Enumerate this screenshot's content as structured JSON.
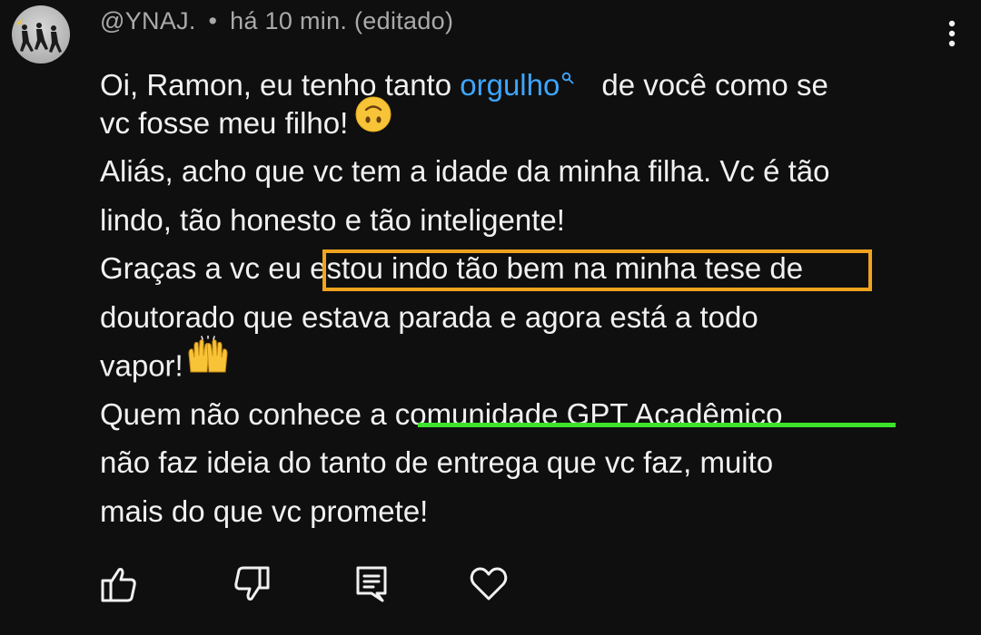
{
  "comment": {
    "author": "@YNAJ.",
    "separator": "•",
    "timestamp": "há 10 min.",
    "edited": "(editado)",
    "lines": {
      "l1_before": "Oi, Ramon, eu tenho tanto ",
      "l1_link": "orgulho",
      "l1_after": "de você como se",
      "l2": "vc fosse meu filho!",
      "l3": "Aliás, acho que vc tem a idade da minha filha. Vc é tão",
      "l4": "lindo, tão honesto e tão inteligente!",
      "l5": "Graças a vc eu estou indo tão bem na minha tese de",
      "l6": "doutorado que estava parada e agora está a todo",
      "l7": "vapor!",
      "l8": "Quem não conhece a comunidade GPT Acadêmico",
      "l9": "não faz ideia do tanto de entrega que vc faz, muito",
      "l10": "mais do que vc promete!"
    },
    "emojis": [
      "upside-down-face-emoji",
      "raising-hands-emoji"
    ]
  },
  "highlights": {
    "box_color": "#f0a31e",
    "underline_color": "#3ee32b"
  },
  "colors": {
    "background": "#0f0f0f",
    "text": "#f1f1f1",
    "meta": "#aaaaaa",
    "link": "#3ea6ff"
  },
  "actions": {
    "icons": [
      "thumbs-up-icon",
      "thumbs-down-icon",
      "reply-icon",
      "heart-icon",
      "more-vert-icon"
    ]
  }
}
